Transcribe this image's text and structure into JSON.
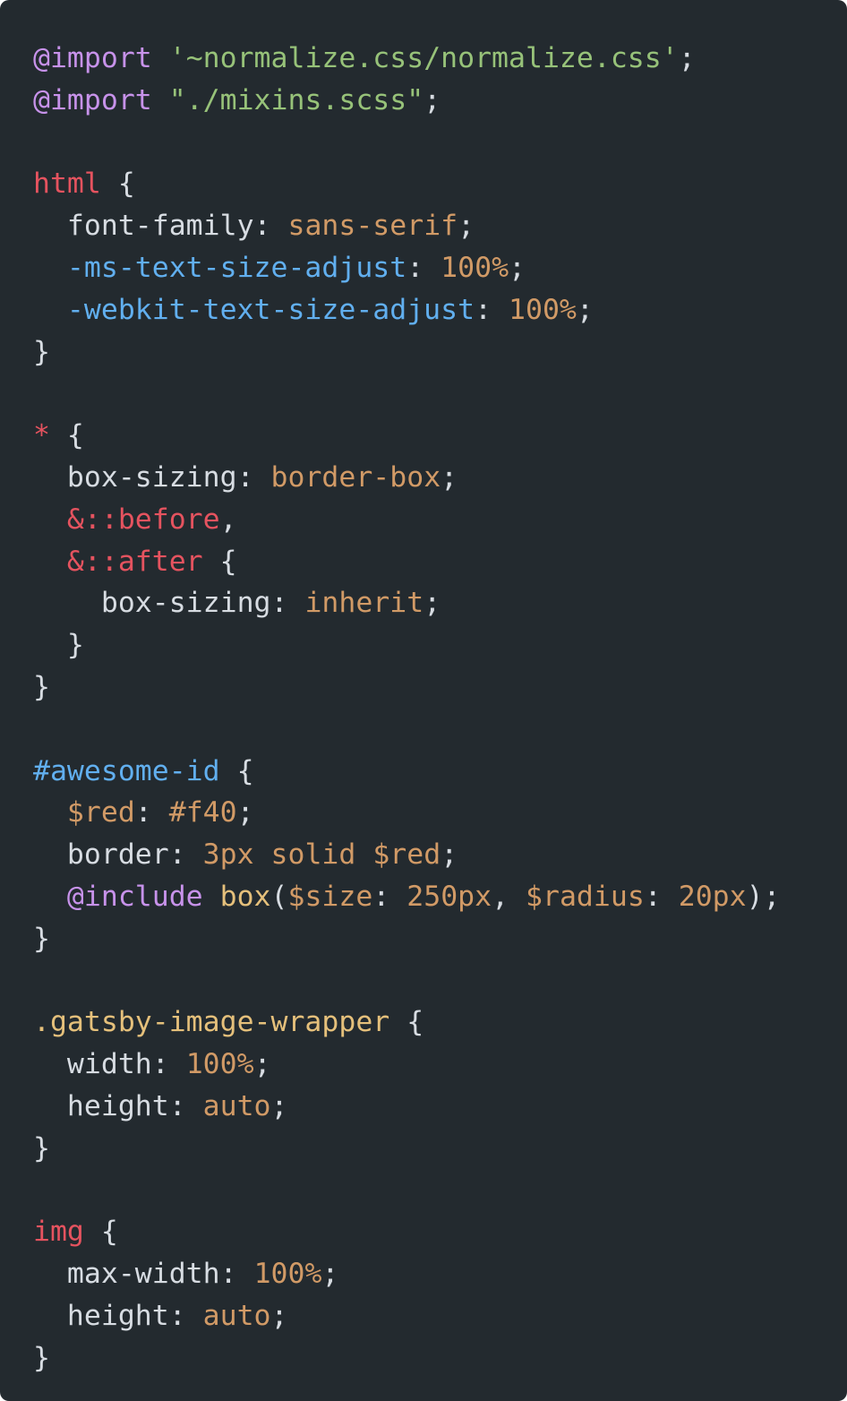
{
  "colors": {
    "background": "#232a2f",
    "default": "#d7dce2",
    "punctuation": "#d7dce2",
    "at_rule": "#c792ea",
    "string": "#97c279",
    "selector": "#e5535f",
    "property": "#d7dce2",
    "vendor_property": "#61afef",
    "value": "#d19a66",
    "id_selector": "#61afef",
    "class_selector": "#e5c07b",
    "variable": "#d19a66"
  },
  "code": {
    "language": "scss",
    "lines": [
      [
        [
          "@import",
          "at_rule"
        ],
        [
          " ",
          "default"
        ],
        [
          "'~normalize.css/normalize.css'",
          "string"
        ],
        [
          ";",
          "punctuation"
        ]
      ],
      [
        [
          "@import",
          "at_rule"
        ],
        [
          " ",
          "default"
        ],
        [
          "\"./mixins.scss\"",
          "string"
        ],
        [
          ";",
          "punctuation"
        ]
      ],
      [],
      [
        [
          "html",
          "selector"
        ],
        [
          " {",
          "punctuation"
        ]
      ],
      [
        [
          "  font-family",
          "property"
        ],
        [
          ": ",
          "punctuation"
        ],
        [
          "sans-serif",
          "value"
        ],
        [
          ";",
          "punctuation"
        ]
      ],
      [
        [
          "  -ms-text-size-adjust",
          "vendor_property"
        ],
        [
          ": ",
          "punctuation"
        ],
        [
          "100%",
          "value"
        ],
        [
          ";",
          "punctuation"
        ]
      ],
      [
        [
          "  -webkit-text-size-adjust",
          "vendor_property"
        ],
        [
          ": ",
          "punctuation"
        ],
        [
          "100%",
          "value"
        ],
        [
          ";",
          "punctuation"
        ]
      ],
      [
        [
          "}",
          "punctuation"
        ]
      ],
      [],
      [
        [
          "*",
          "selector"
        ],
        [
          " {",
          "punctuation"
        ]
      ],
      [
        [
          "  box-sizing",
          "property"
        ],
        [
          ": ",
          "punctuation"
        ],
        [
          "border-box",
          "value"
        ],
        [
          ";",
          "punctuation"
        ]
      ],
      [
        [
          "  &::before",
          "selector"
        ],
        [
          ",",
          "punctuation"
        ]
      ],
      [
        [
          "  &::after",
          "selector"
        ],
        [
          " {",
          "punctuation"
        ]
      ],
      [
        [
          "    box-sizing",
          "property"
        ],
        [
          ": ",
          "punctuation"
        ],
        [
          "inherit",
          "value"
        ],
        [
          ";",
          "punctuation"
        ]
      ],
      [
        [
          "  }",
          "punctuation"
        ]
      ],
      [
        [
          "}",
          "punctuation"
        ]
      ],
      [],
      [
        [
          "#awesome-id",
          "id_selector"
        ],
        [
          " {",
          "punctuation"
        ]
      ],
      [
        [
          "  $red",
          "variable"
        ],
        [
          ": ",
          "punctuation"
        ],
        [
          "#f40",
          "value"
        ],
        [
          ";",
          "punctuation"
        ]
      ],
      [
        [
          "  border",
          "property"
        ],
        [
          ": ",
          "punctuation"
        ],
        [
          "3px",
          "value"
        ],
        [
          " ",
          "default"
        ],
        [
          "solid",
          "value"
        ],
        [
          " ",
          "default"
        ],
        [
          "$red",
          "variable"
        ],
        [
          ";",
          "punctuation"
        ]
      ],
      [
        [
          "  @include",
          "at_rule"
        ],
        [
          " ",
          "default"
        ],
        [
          "box",
          "class_selector"
        ],
        [
          "(",
          "punctuation"
        ],
        [
          "$size",
          "variable"
        ],
        [
          ": ",
          "punctuation"
        ],
        [
          "250px",
          "value"
        ],
        [
          ", ",
          "punctuation"
        ],
        [
          "$radius",
          "variable"
        ],
        [
          ": ",
          "punctuation"
        ],
        [
          "20px",
          "value"
        ],
        [
          ");",
          "punctuation"
        ]
      ],
      [
        [
          "}",
          "punctuation"
        ]
      ],
      [],
      [
        [
          ".gatsby-image-wrapper",
          "class_selector"
        ],
        [
          " {",
          "punctuation"
        ]
      ],
      [
        [
          "  width",
          "property"
        ],
        [
          ": ",
          "punctuation"
        ],
        [
          "100%",
          "value"
        ],
        [
          ";",
          "punctuation"
        ]
      ],
      [
        [
          "  height",
          "property"
        ],
        [
          ": ",
          "punctuation"
        ],
        [
          "auto",
          "value"
        ],
        [
          ";",
          "punctuation"
        ]
      ],
      [
        [
          "}",
          "punctuation"
        ]
      ],
      [],
      [
        [
          "img",
          "selector"
        ],
        [
          " {",
          "punctuation"
        ]
      ],
      [
        [
          "  max-width",
          "property"
        ],
        [
          ": ",
          "punctuation"
        ],
        [
          "100%",
          "value"
        ],
        [
          ";",
          "punctuation"
        ]
      ],
      [
        [
          "  height",
          "property"
        ],
        [
          ": ",
          "punctuation"
        ],
        [
          "auto",
          "value"
        ],
        [
          ";",
          "punctuation"
        ]
      ],
      [
        [
          "}",
          "punctuation"
        ]
      ]
    ]
  }
}
